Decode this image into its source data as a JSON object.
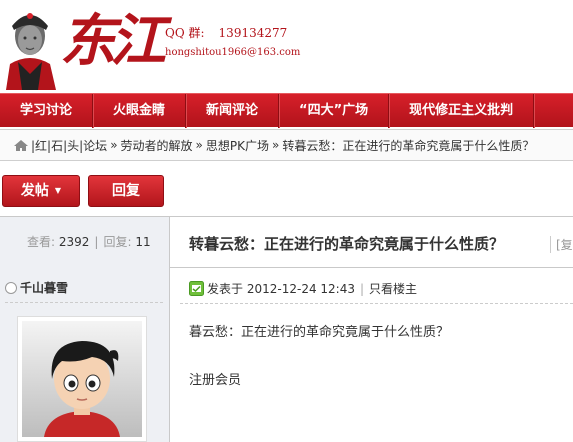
{
  "header": {
    "logo_text": "东江",
    "qq_label": "QQ 群:",
    "qq_number": "139134277",
    "email": "hongshitou1966@163.com"
  },
  "nav": {
    "items": [
      {
        "label": "学习讨论"
      },
      {
        "label": "火眼金睛"
      },
      {
        "label": "新闻评论"
      },
      {
        "label": "“四大”广场"
      },
      {
        "label": "现代修正主义批判"
      }
    ]
  },
  "breadcrumb": {
    "items": [
      {
        "label": "|红|石|头|论坛"
      },
      {
        "label": "劳动者的解放"
      },
      {
        "label": "思想PK广场"
      },
      {
        "label": "转暮云愁：正在进行的革命究竟属于什么性质？"
      }
    ],
    "separator": "»"
  },
  "actions": {
    "post_label": "发帖",
    "reply_label": "回复"
  },
  "thread": {
    "views_label": "查看:",
    "views": "2392",
    "replies_label": "回复:",
    "replies": "11",
    "title": "转暮云愁：正在进行的革命究竟属于什么性质？",
    "copy_link_label": "[复"
  },
  "post": {
    "author": "千山暮雪",
    "posted_label": "发表于",
    "posted_time": "2012-12-24 12:43",
    "only_author_label": "只看楼主",
    "body_title": "暮云愁：正在进行的革命究竟属于什么性质？",
    "body_line": "注册会员"
  },
  "colors": {
    "brand_red": "#b3141b",
    "nav_red": "#d7202a"
  }
}
